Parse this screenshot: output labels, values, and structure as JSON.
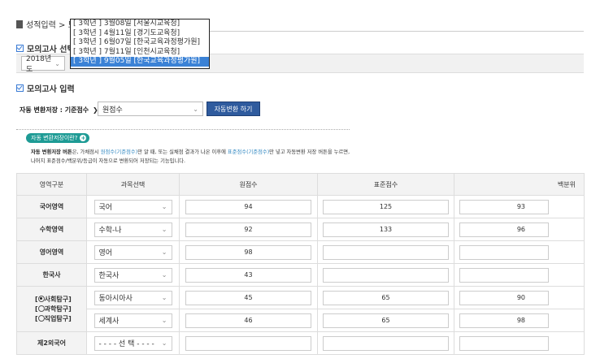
{
  "breadcrumb": {
    "text": "성적입력 > 모"
  },
  "sections": {
    "exam_select": "모의고사 선택",
    "exam_input": "모의고사 입력"
  },
  "year_select": {
    "value": "2018년도"
  },
  "exam_dropdown": {
    "options": [
      "[ 3학년 ] 3월08일 [서울시교육청]",
      "[ 3학년 ] 4월11일 [경기도교육청]",
      "[ 3학년 ] 6월07일 [한국교육과정평가원]",
      "[ 3학년 ] 7월11일 [인천시교육청]",
      "[ 3학년 ] 9월05일 [한국교육과정평가원]"
    ],
    "selected_index": 4
  },
  "conversion": {
    "label": "자동 변환저장 : 기준점수",
    "arrow": "❯",
    "select_value": "원점수",
    "button": "자동변환 하기"
  },
  "help": {
    "pill": "자동 변환저장이란?",
    "line1_a": "자동 변환저장 버튼",
    "line1_b": "은, 가채점시 ",
    "line1_c": "원점수(기준점수)",
    "line1_d": "만 알 때, 또는 실채점 결과가 나온 이후에 ",
    "line1_e": "표준점수(기준점수)",
    "line1_f": "만 넣고 자동변환 저장 버튼을 누르면,",
    "line2": "나머지 표준점수/백분위/등급이 자동으로 변환되어 저장되는 기능입니다."
  },
  "table": {
    "headers": [
      "영역구분",
      "과목선택",
      "원점수",
      "표준점수",
      "백분위"
    ],
    "rows": [
      {
        "label": "국어영역",
        "subject": "국어",
        "raw": "94",
        "std": "125",
        "pct": "93"
      },
      {
        "label": "수학영역",
        "subject": "수학-나",
        "raw": "92",
        "std": "133",
        "pct": "96"
      },
      {
        "label": "영어영역",
        "subject": "영어",
        "raw": "98",
        "std": "",
        "pct": ""
      },
      {
        "label": "한국사",
        "subject": "한국사",
        "raw": "43",
        "std": "",
        "pct": ""
      },
      {
        "label": "",
        "subject": "동아시아사",
        "raw": "45",
        "std": "65",
        "pct": "90"
      },
      {
        "label": "",
        "subject": "세계사",
        "raw": "46",
        "std": "65",
        "pct": "98"
      },
      {
        "label": "제2외국어",
        "subject": "- - - - 선 택 - - - -",
        "raw": "",
        "std": "",
        "pct": ""
      }
    ],
    "inquiry": {
      "social": "사회탐구",
      "science": "과학탐구",
      "vocational": "직업탐구",
      "selected": "social"
    }
  }
}
